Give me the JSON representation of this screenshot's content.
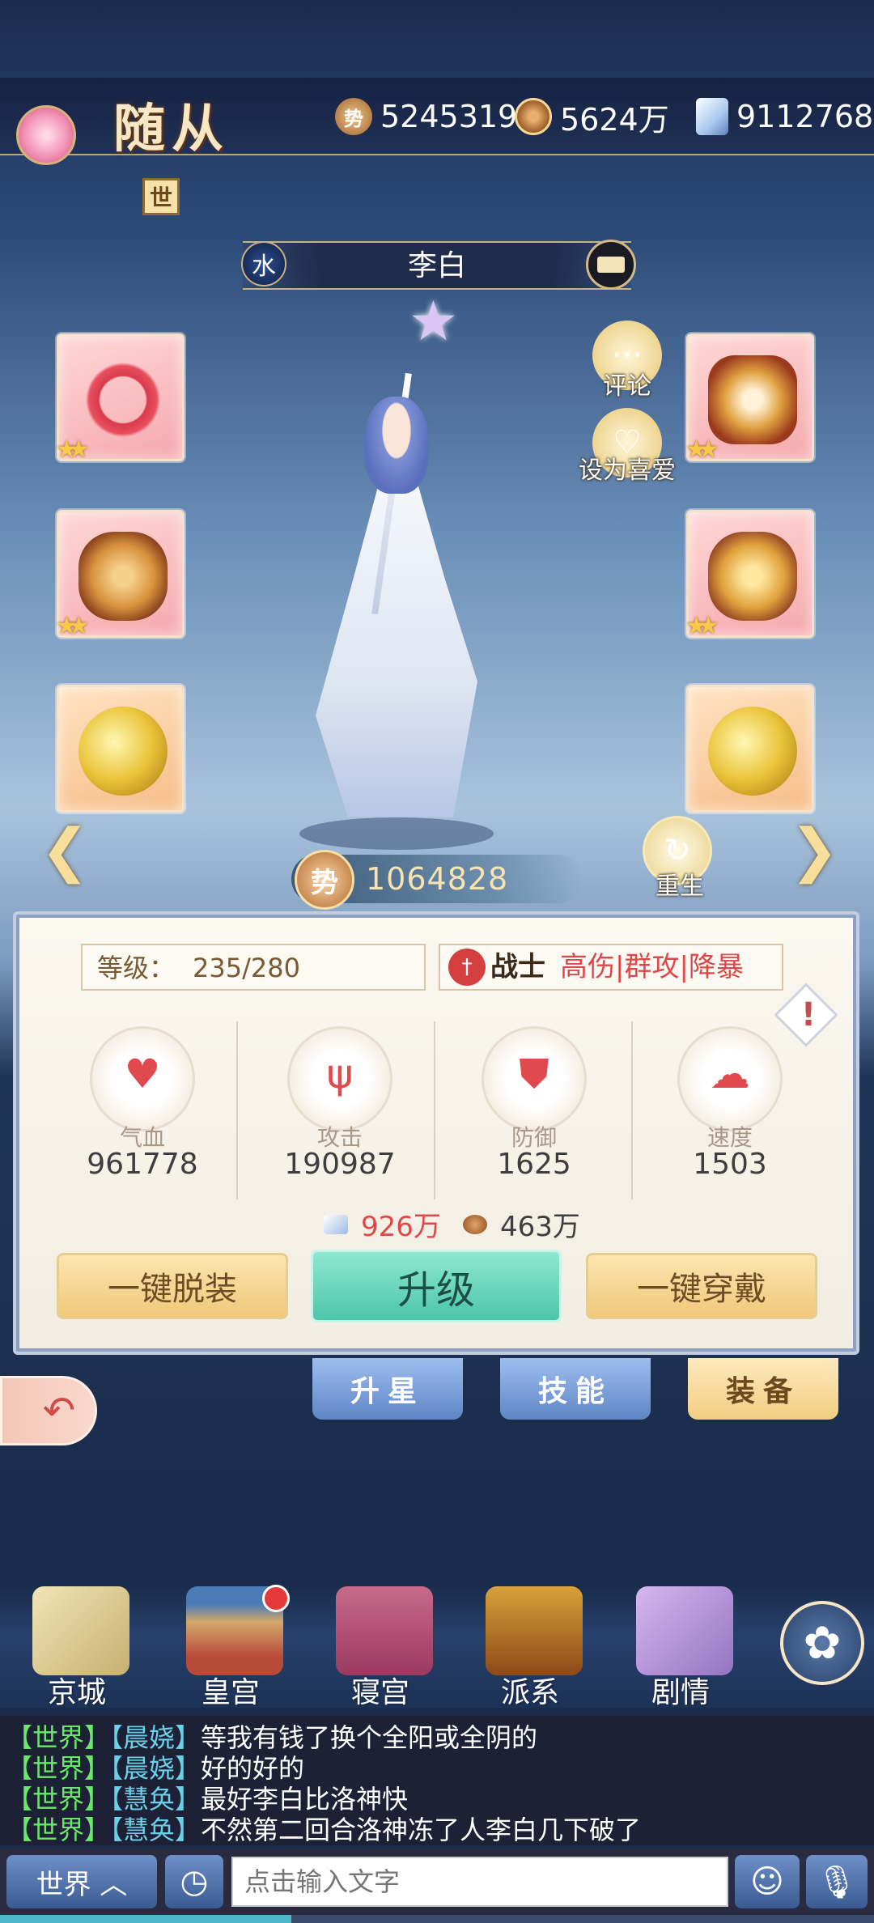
{
  "header": {
    "title": "随从",
    "world_badge": "世",
    "resources": {
      "power": "5245319",
      "power_icon_glyph": "势",
      "coins": "5624万",
      "books": "9112768"
    }
  },
  "character": {
    "element": "水",
    "name": "李白",
    "power_glyph": "势",
    "power": "1064828"
  },
  "side_buttons": {
    "comment": "评论",
    "favorite": "设为喜爱",
    "rebirth": "重生"
  },
  "equipment_slots": [
    {
      "slot": 1,
      "stars": "★★",
      "rarity": "pink"
    },
    {
      "slot": 2,
      "stars": "★★",
      "rarity": "pink"
    },
    {
      "slot": 3,
      "stars": "★★",
      "rarity": "pink"
    },
    {
      "slot": 4,
      "stars": "★★",
      "rarity": "pink"
    },
    {
      "slot": 5,
      "stars": "",
      "rarity": "orange"
    },
    {
      "slot": 6,
      "stars": "",
      "rarity": "orange"
    }
  ],
  "panel": {
    "level_label": "等级：",
    "level_value": "235/280",
    "class_name": "战士",
    "class_tags": "高伤|群攻|降暴",
    "info_glyph": "!",
    "stats": [
      {
        "label": "气血",
        "value": "961778",
        "icon": "heart-icon"
      },
      {
        "label": "攻击",
        "value": "190987",
        "icon": "trident-icon"
      },
      {
        "label": "防御",
        "value": "1625",
        "icon": "shield-icon"
      },
      {
        "label": "速度",
        "value": "1503",
        "icon": "cloud-icon"
      }
    ],
    "cost_books": "926万",
    "cost_coins": "463万",
    "buttons": {
      "unequip_all": "一键脱装",
      "upgrade": "升级",
      "equip_all": "一键穿戴"
    }
  },
  "tabs": {
    "star": "升星",
    "skill": "技能",
    "equip": "装备"
  },
  "nav": {
    "capital": "京城",
    "palace": "皇宫",
    "chamber": "寝宫",
    "faction": "派系",
    "story": "剧情"
  },
  "chat": {
    "messages": [
      {
        "channel": "【世界】",
        "user": "【晨娆】",
        "text": "等我有钱了换个全阳或全阴的"
      },
      {
        "channel": "【世界】",
        "user": "【晨娆】",
        "text": "好的好的"
      },
      {
        "channel": "【世界】",
        "user": "【慧奂】",
        "text": "最好李白比洛神快"
      },
      {
        "channel": "【世界】",
        "user": "【慧奂】",
        "text": "不然第二回合洛神冻了人李白几下破了"
      }
    ],
    "channel_button": "世界 ︿",
    "input_placeholder": "点击输入文字"
  },
  "colors": {
    "accent_gold": "#c7a56a",
    "upgrade_green": "#4cc6a8",
    "tag_red": "#e0474a",
    "chat_channel_green": "#6be86b",
    "chat_user_cyan": "#6ad0e8"
  }
}
